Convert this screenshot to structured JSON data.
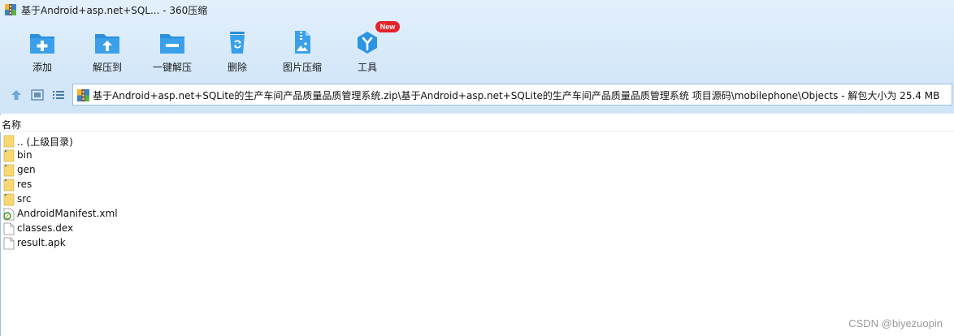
{
  "window": {
    "title": "基于Android+asp.net+SQL... - 360压缩"
  },
  "toolbar": {
    "items": [
      {
        "label": "添加",
        "icon": "add-icon"
      },
      {
        "label": "解压到",
        "icon": "extract-to-icon"
      },
      {
        "label": "一键解压",
        "icon": "one-click-extract-icon"
      },
      {
        "label": "删除",
        "icon": "delete-icon"
      },
      {
        "label": "图片压缩",
        "icon": "image-compress-icon"
      },
      {
        "label": "工具",
        "icon": "tools-icon",
        "badge": "New"
      }
    ]
  },
  "address": {
    "path": "基于Android+asp.net+SQLite的生产车间产品质量品质管理系统.zip\\基于Android+asp.net+SQLite的生产车间产品质量品质管理系统 项目源码\\mobilephone\\Objects - 解包大小为 25.4 MB"
  },
  "list": {
    "header_name": "名称",
    "items": [
      {
        "name": ".. (上级目录)",
        "type": "parent"
      },
      {
        "name": "bin",
        "type": "folder"
      },
      {
        "name": "gen",
        "type": "folder"
      },
      {
        "name": "res",
        "type": "folder"
      },
      {
        "name": "src",
        "type": "folder"
      },
      {
        "name": "AndroidManifest.xml",
        "type": "xml"
      },
      {
        "name": "classes.dex",
        "type": "file"
      },
      {
        "name": "result.apk",
        "type": "file"
      }
    ]
  },
  "watermark": "CSDN @biyezuopin",
  "colors": {
    "accent": "#2196e0",
    "badge": "#e4242b",
    "folder": "#f8d775"
  }
}
